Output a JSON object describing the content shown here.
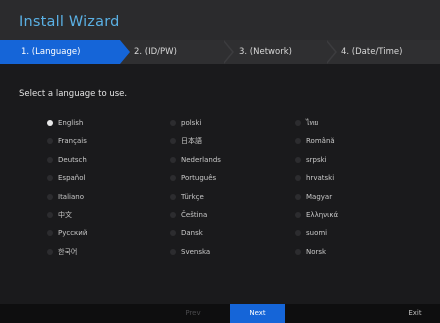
{
  "wizard": {
    "title": "Install Wizard"
  },
  "steps": [
    {
      "label": "1.  (Language)"
    },
    {
      "label": "2.  (ID/PW)"
    },
    {
      "label": "3.  (Network)"
    },
    {
      "label": "4.  (Date/Time)"
    }
  ],
  "prompt": "Select a language to use.",
  "languages": [
    {
      "label": "English",
      "selected": true
    },
    {
      "label": "polski",
      "selected": false
    },
    {
      "label": "ไทย",
      "selected": false
    },
    {
      "label": "Français",
      "selected": false
    },
    {
      "label": "日本語",
      "selected": false
    },
    {
      "label": "Română",
      "selected": false
    },
    {
      "label": "Deutsch",
      "selected": false
    },
    {
      "label": "Nederlands",
      "selected": false
    },
    {
      "label": "srpski",
      "selected": false
    },
    {
      "label": "Español",
      "selected": false
    },
    {
      "label": "Português",
      "selected": false
    },
    {
      "label": "hrvatski",
      "selected": false
    },
    {
      "label": "Italiano",
      "selected": false
    },
    {
      "label": "Türkçe",
      "selected": false
    },
    {
      "label": "Magyar",
      "selected": false
    },
    {
      "label": "中文",
      "selected": false
    },
    {
      "label": "Čeština",
      "selected": false
    },
    {
      "label": "Ελληνικά",
      "selected": false
    },
    {
      "label": "Русский",
      "selected": false
    },
    {
      "label": "Dansk",
      "selected": false
    },
    {
      "label": "suomi",
      "selected": false
    },
    {
      "label": "한국어",
      "selected": false
    },
    {
      "label": "Svenska",
      "selected": false
    },
    {
      "label": "Norsk",
      "selected": false
    }
  ],
  "buttons": {
    "prev": "Prev",
    "next": "Next",
    "exit": "Exit"
  },
  "colors": {
    "accent": "#1565d8",
    "title": "#5ab0e4"
  }
}
